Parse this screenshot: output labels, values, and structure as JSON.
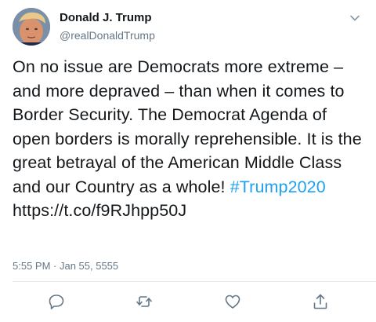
{
  "user": {
    "display_name": "Donald J. Trump",
    "handle": "@realDonaldTrump"
  },
  "tweet": {
    "text_main": "On no issue are Democrats more extreme – and more depraved – than when it comes to Border Security. The Democrat Agenda of open borders is morally reprehensible. It is the great betrayal of the American Middle Class and our Country as a whole! ",
    "hashtag": "#Trump2020",
    "link": "https://t.co/f9RJhpp50J",
    "timestamp": "5:55 PM · Jan 55, 5555"
  },
  "icons": {
    "menu": "chevron-down-icon",
    "reply": "reply-icon",
    "retweet": "retweet-icon",
    "like": "heart-icon",
    "share": "share-icon"
  },
  "colors": {
    "text": "#14171a",
    "secondary": "#657786",
    "accent": "#1da1f2",
    "divider": "#e1e8ed"
  }
}
